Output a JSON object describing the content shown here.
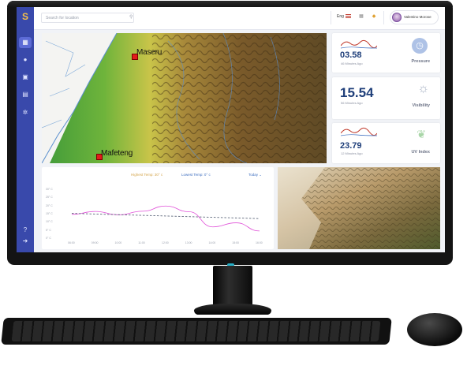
{
  "app": {
    "logo_glyph": "S"
  },
  "search": {
    "placeholder": "Search for location"
  },
  "topbar": {
    "language": "Eng",
    "user_name": "Valentino Morose"
  },
  "sidebar": {
    "icons": [
      "dashboard-icon",
      "user-icon",
      "calendar-icon",
      "document-icon",
      "settings-icon",
      "help-icon",
      "logout-icon"
    ]
  },
  "map": {
    "city_north": "Maseru",
    "city_south": "Mafeteng"
  },
  "cards": [
    {
      "value": "03.58",
      "sub": "46 Minutes Ago",
      "label": "Pressure",
      "icon": "clock-icon",
      "spark_color": "#c0392b"
    },
    {
      "value": "15.54",
      "sub": "56 Minutes Ago",
      "label": "Visibility",
      "icon": "sun-icon",
      "spark_color": "#c0392b"
    },
    {
      "value": "23.79",
      "sub": "12 Minutes Ago",
      "label": "UV Index",
      "icon": "leaf-icon",
      "spark_color": "#c0392b"
    }
  ],
  "chart_data": {
    "type": "line",
    "legend": {
      "high": "Highest Temp: 30° c",
      "low": "Lowest Temp: 0° c"
    },
    "period": "Today",
    "x": [
      "06:00",
      "09:00",
      "10:00",
      "11:00",
      "12:00",
      "13:00",
      "14:00",
      "15:00",
      "16:00"
    ],
    "y_ticks": [
      "30° C",
      "25° C",
      "20° C",
      "15° C",
      "10° C",
      "5° C",
      "0° C"
    ],
    "ylim": [
      0,
      30
    ],
    "series": [
      {
        "values": [
          14.6,
          16.4,
          14.3,
          16.5,
          19.7,
          16.2,
          6.9,
          9.4,
          4.4
        ],
        "color": "#e050d8",
        "style": "solid"
      },
      {
        "values": [
          15.2,
          14.8,
          14.4,
          14.0,
          13.6,
          13.2,
          12.8,
          12.4,
          12.0
        ],
        "color": "#5a6478",
        "style": "dashed"
      }
    ]
  },
  "colors": {
    "sidebar": "#3949ab",
    "accent": "#1f3f7a",
    "high_temp": "#d4a44a",
    "low_temp": "#3f6fc0"
  }
}
